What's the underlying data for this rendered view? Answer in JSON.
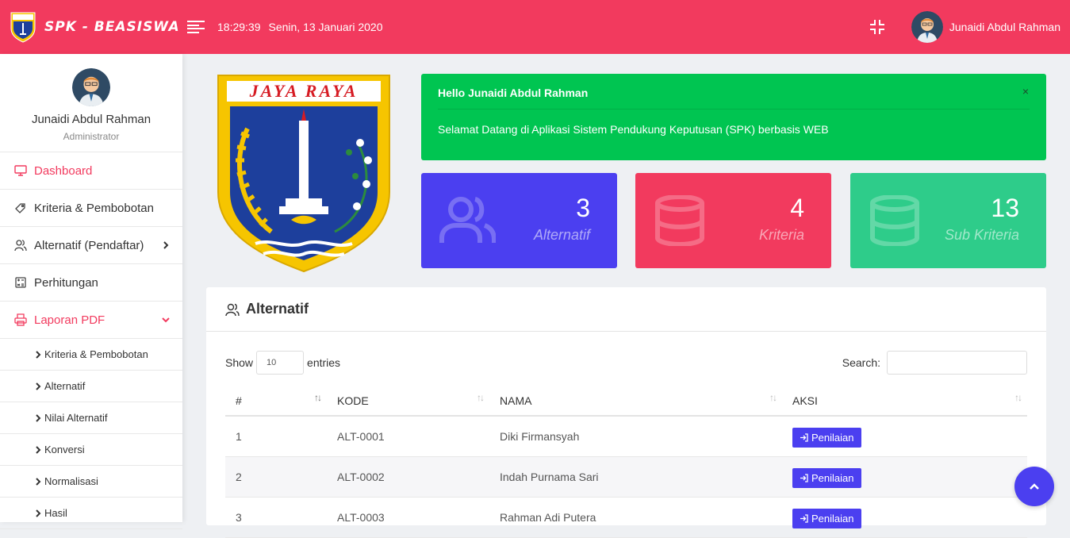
{
  "header": {
    "brand": "SPK - BEASISWA",
    "time": "18:29:39",
    "date": "Senin, 13 Januari 2020",
    "user": "Junaidi Abdul Rahman"
  },
  "sidebar": {
    "profile_name": "Junaidi Abdul Rahman",
    "profile_role": "Administrator",
    "items": [
      {
        "label": "Dashboard",
        "icon": "monitor-icon",
        "active": true
      },
      {
        "label": "Kriteria & Pembobotan",
        "icon": "tag-icon"
      },
      {
        "label": "Alternatif (Pendaftar)",
        "icon": "users-icon",
        "chevron": "right"
      },
      {
        "label": "Perhitungan",
        "icon": "calculator-icon"
      },
      {
        "label": "Laporan PDF",
        "icon": "printer-icon",
        "chevron": "down",
        "open": true
      }
    ],
    "subitems": [
      "Kriteria & Pembobotan",
      "Alternatif",
      "Nilai Alternatif",
      "Konversi",
      "Normalisasi",
      "Hasil"
    ]
  },
  "emblem": {
    "text": "JAYA RAYA"
  },
  "alert": {
    "title": "Hello Junaidi Abdul Rahman",
    "message": "Selamat Datang di Aplikasi Sistem Pendukung Keputusan (SPK) berbasis WEB",
    "close": "×"
  },
  "stats": [
    {
      "value": "3",
      "label": "Alternatif",
      "color": "#4b3ff0",
      "icon": "users-icon"
    },
    {
      "value": "4",
      "label": "Kriteria",
      "color": "#f23a5e",
      "icon": "database-icon"
    },
    {
      "value": "13",
      "label": "Sub Kriteria",
      "color": "#2ecc8a",
      "icon": "database-icon"
    }
  ],
  "table_card": {
    "title": "Alternatif",
    "show_label": "Show",
    "entries_value": "10",
    "entries_label": "entries",
    "search_label": "Search:",
    "columns": [
      "#",
      "KODE",
      "NAMA",
      "AKSI"
    ],
    "rows": [
      {
        "no": "1",
        "kode": "ALT-0001",
        "nama": "Diki Firmansyah",
        "aksi": "Penilaian"
      },
      {
        "no": "2",
        "kode": "ALT-0002",
        "nama": "Indah Purnama Sari",
        "aksi": "Penilaian"
      },
      {
        "no": "3",
        "kode": "ALT-0003",
        "nama": "Rahman Adi Putera",
        "aksi": "Penilaian"
      }
    ]
  },
  "colors": {
    "primary": "#f23a5e",
    "success": "#00c551",
    "accent": "#4b3ff0"
  }
}
